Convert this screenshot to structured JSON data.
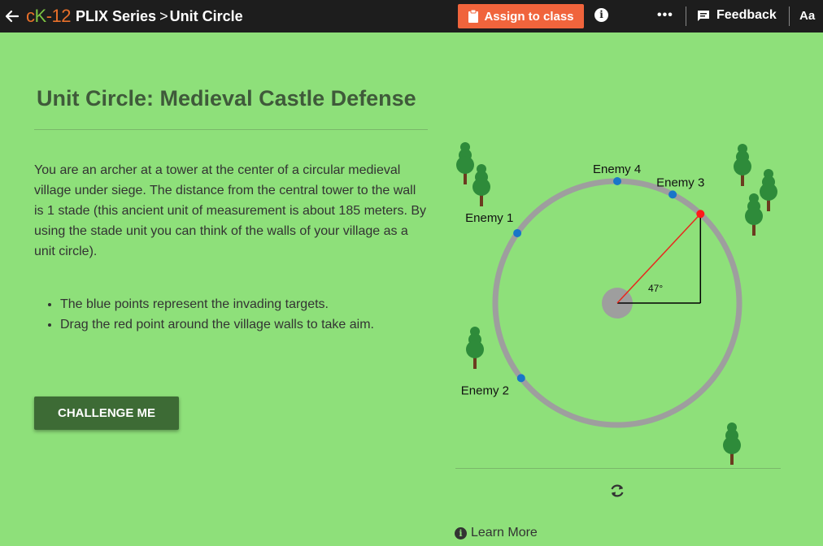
{
  "header": {
    "logo": {
      "c": "c",
      "k": "K",
      "num": "-12"
    },
    "series": "PLIX Series",
    "separator": ">",
    "page": "Unit Circle",
    "assign_label": "Assign to class",
    "more_label": "•••",
    "feedback_label": "Feedback",
    "aa_label": "Aa"
  },
  "main": {
    "title": "Unit Circle: Medieval Castle Defense",
    "description": "You are an archer at a tower at the center of a circular medieval village under siege. The distance from the central tower to the wall is 1 stade (this ancient unit of measurement is about 185 meters. By using the stade unit you can think of the walls of your village as a unit circle).",
    "bullets": [
      "The blue points represent the invading targets.",
      "Drag the red point around the village walls to take aim."
    ],
    "challenge_label": "CHALLENGE ME",
    "learn_more_label": "Learn More"
  },
  "diagram": {
    "angle_label": "47°",
    "aim_angle_deg": 47,
    "enemies": [
      {
        "label": "Enemy 1",
        "angle_deg": 145
      },
      {
        "label": "Enemy 2",
        "angle_deg": 218
      },
      {
        "label": "Enemy 3",
        "angle_deg": 63
      },
      {
        "label": "Enemy 4",
        "angle_deg": 90
      }
    ]
  },
  "colors": {
    "background": "#8ee07a",
    "topbar": "#1d1d1d",
    "assign_button": "#f0643c",
    "title": "#3f5a3a",
    "challenge_button": "#3d6b35",
    "wall": "#9e9e9e",
    "aim_point": "#ff1a1a",
    "enemy_point": "#1976c8"
  }
}
